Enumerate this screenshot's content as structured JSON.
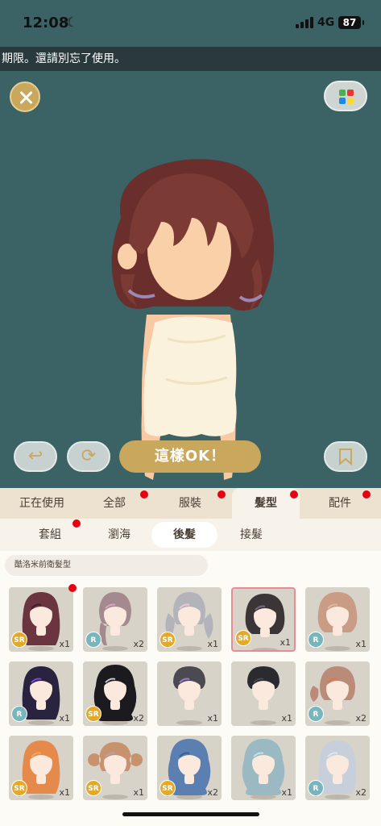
{
  "status_bar": {
    "time": "12:08",
    "network": "4G",
    "battery": "87"
  },
  "banner": {
    "text": "期限。還請別忘了使用。"
  },
  "controls": {
    "ok_label": "這樣OK！"
  },
  "category_tabs": [
    {
      "label": "正在使用",
      "dot": false,
      "active": false
    },
    {
      "label": "全部",
      "dot": true,
      "active": false
    },
    {
      "label": "服裝",
      "dot": true,
      "active": false
    },
    {
      "label": "髮型",
      "dot": true,
      "active": true
    },
    {
      "label": "配件",
      "dot": true,
      "active": false
    }
  ],
  "sub_tabs": [
    {
      "label": "套組",
      "dot": true,
      "active": false
    },
    {
      "label": "瀏海",
      "dot": false,
      "active": false
    },
    {
      "label": "後髮",
      "dot": false,
      "active": true
    },
    {
      "label": "接髮",
      "dot": false,
      "active": false
    }
  ],
  "collection": {
    "label": "酷洛米前衛髮型"
  },
  "items": [
    {
      "rarity": "SR",
      "qty": "x1",
      "hair": "#6b3540",
      "accent": "#3b1f2a",
      "style": "long",
      "new": true
    },
    {
      "rarity": "R",
      "qty": "x2",
      "hair": "#a48a8f",
      "accent": "#d7a6c2",
      "style": "braid",
      "new": false
    },
    {
      "rarity": "SR",
      "qty": "x1",
      "hair": "#b3b3bb",
      "accent": "#f2c4d9",
      "style": "twin",
      "new": false
    },
    {
      "rarity": "SR",
      "qty": "x1",
      "hair": "#3b3538",
      "accent": "#7d6a80",
      "style": "bob",
      "new": false,
      "selected": true
    },
    {
      "rarity": "R",
      "qty": "x1",
      "hair": "#c99c86",
      "accent": "#e0b7a0",
      "style": "bob",
      "new": false
    },
    {
      "rarity": "R",
      "qty": "x1",
      "hair": "#2a2340",
      "accent": "#7e4bd6",
      "style": "long",
      "new": false
    },
    {
      "rarity": "SR",
      "qty": "x2",
      "hair": "#1a1a1f",
      "accent": "#c6c6d0",
      "style": "wavy",
      "new": false
    },
    {
      "rarity": "",
      "qty": "x1",
      "hair": "#4b4a52",
      "accent": "#9d7ccf",
      "style": "short",
      "new": false
    },
    {
      "rarity": "",
      "qty": "x1",
      "hair": "#2b2a2e",
      "accent": "#4a4850",
      "style": "short",
      "new": false
    },
    {
      "rarity": "R",
      "qty": "x2",
      "hair": "#b98b78",
      "accent": "#d8794d",
      "style": "side",
      "new": false
    },
    {
      "rarity": "SR",
      "qty": "x1",
      "hair": "#e58a4a",
      "accent": "#f0a864",
      "style": "long",
      "new": false
    },
    {
      "rarity": "SR",
      "qty": "x1",
      "hair": "#c9926f",
      "accent": "#a7a7b6",
      "style": "bun",
      "new": false
    },
    {
      "rarity": "SR",
      "qty": "x2",
      "hair": "#5a7fb0",
      "accent": "#3b5d92",
      "style": "wavy",
      "new": false
    },
    {
      "rarity": "",
      "qty": "x1",
      "hair": "#9bb9c2",
      "accent": "#c8dfe4",
      "style": "wavy",
      "new": false
    },
    {
      "rarity": "R",
      "qty": "x2",
      "hair": "#c7cfdb",
      "accent": "#e2e7ef",
      "style": "long",
      "new": false
    }
  ],
  "colors": {
    "stage": "#3b6264",
    "gold": "#c9a85d",
    "badge_sr": "#e3aa2a",
    "badge_r": "#79b5bd",
    "notify": "#e60012"
  },
  "icons": [
    "close-icon",
    "color-grid-icon",
    "undo-icon",
    "refresh-icon",
    "bookmark-icon",
    "moon-icon"
  ]
}
